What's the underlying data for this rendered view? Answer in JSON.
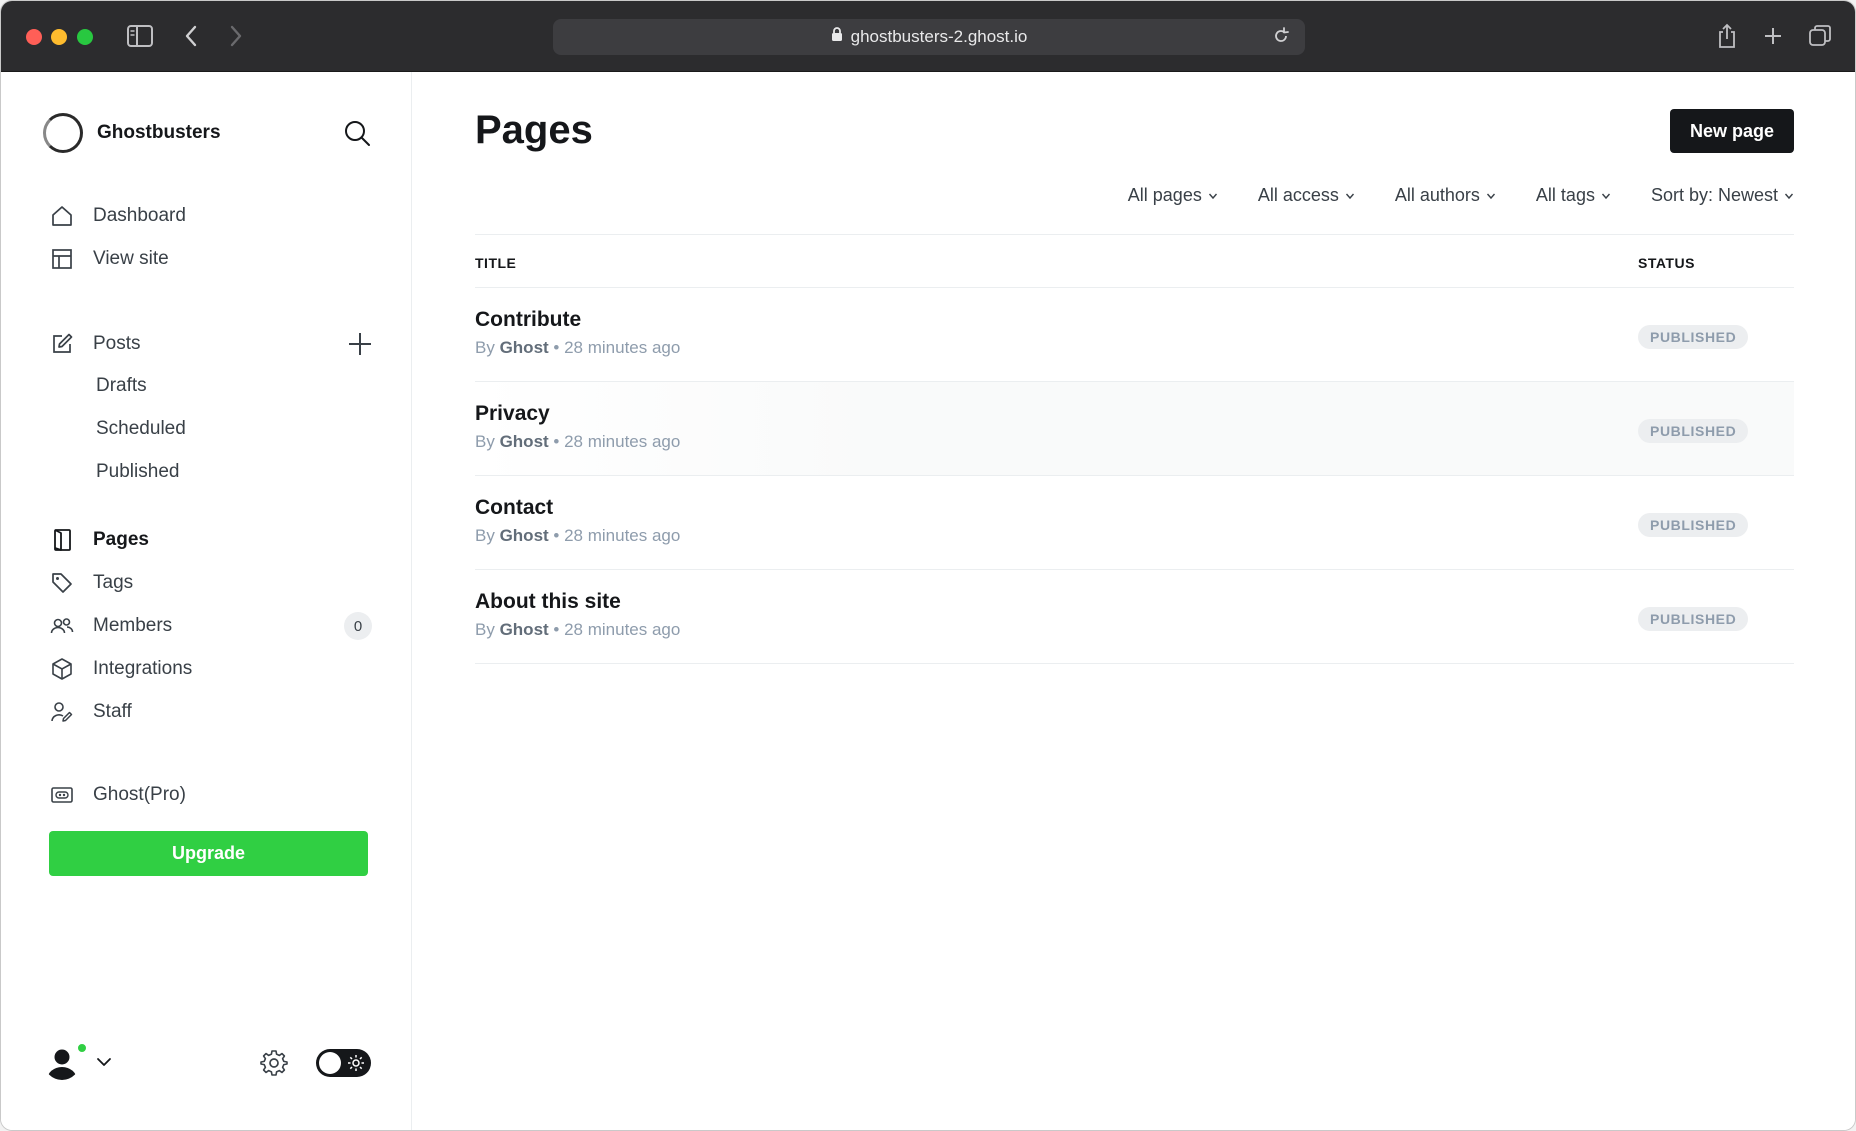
{
  "browser": {
    "url": "ghostbusters-2.ghost.io",
    "icons": [
      "sidebar-toggle-icon",
      "back-icon",
      "forward-icon",
      "lock-icon",
      "reload-icon",
      "share-icon",
      "new-tab-icon",
      "tab-overview-icon"
    ]
  },
  "sidebar": {
    "brand": "Ghostbusters",
    "nav_top": [
      {
        "label": "Dashboard",
        "icon": "home-icon"
      },
      {
        "label": "View site",
        "icon": "layout-icon"
      }
    ],
    "posts": {
      "label": "Posts",
      "icon": "edit-icon",
      "sub": [
        "Drafts",
        "Scheduled",
        "Published"
      ]
    },
    "nav_mid": [
      {
        "label": "Pages",
        "icon": "page-icon",
        "active": true
      },
      {
        "label": "Tags",
        "icon": "tag-icon"
      },
      {
        "label": "Members",
        "icon": "members-icon",
        "count": "0"
      },
      {
        "label": "Integrations",
        "icon": "box-icon"
      },
      {
        "label": "Staff",
        "icon": "staff-icon"
      }
    ],
    "pro": {
      "label": "Ghost(Pro)",
      "icon": "ghost-pro-icon"
    },
    "upgrade_label": "Upgrade"
  },
  "main": {
    "title": "Pages",
    "new_button": "New page",
    "filters": [
      "All pages",
      "All access",
      "All authors",
      "All tags",
      "Sort by: Newest"
    ],
    "columns": {
      "title": "TITLE",
      "status": "STATUS"
    },
    "rows": [
      {
        "title": "Contribute",
        "by": "By",
        "author": "Ghost",
        "time": "28 minutes ago",
        "status": "PUBLISHED"
      },
      {
        "title": "Privacy",
        "by": "By",
        "author": "Ghost",
        "time": "28 minutes ago",
        "status": "PUBLISHED"
      },
      {
        "title": "Contact",
        "by": "By",
        "author": "Ghost",
        "time": "28 minutes ago",
        "status": "PUBLISHED"
      },
      {
        "title": "About this site",
        "by": "By",
        "author": "Ghost",
        "time": "28 minutes ago",
        "status": "PUBLISHED"
      }
    ]
  },
  "colors": {
    "accent_green": "#30cf43",
    "dark": "#15171a",
    "muted": "#8e9cac"
  }
}
